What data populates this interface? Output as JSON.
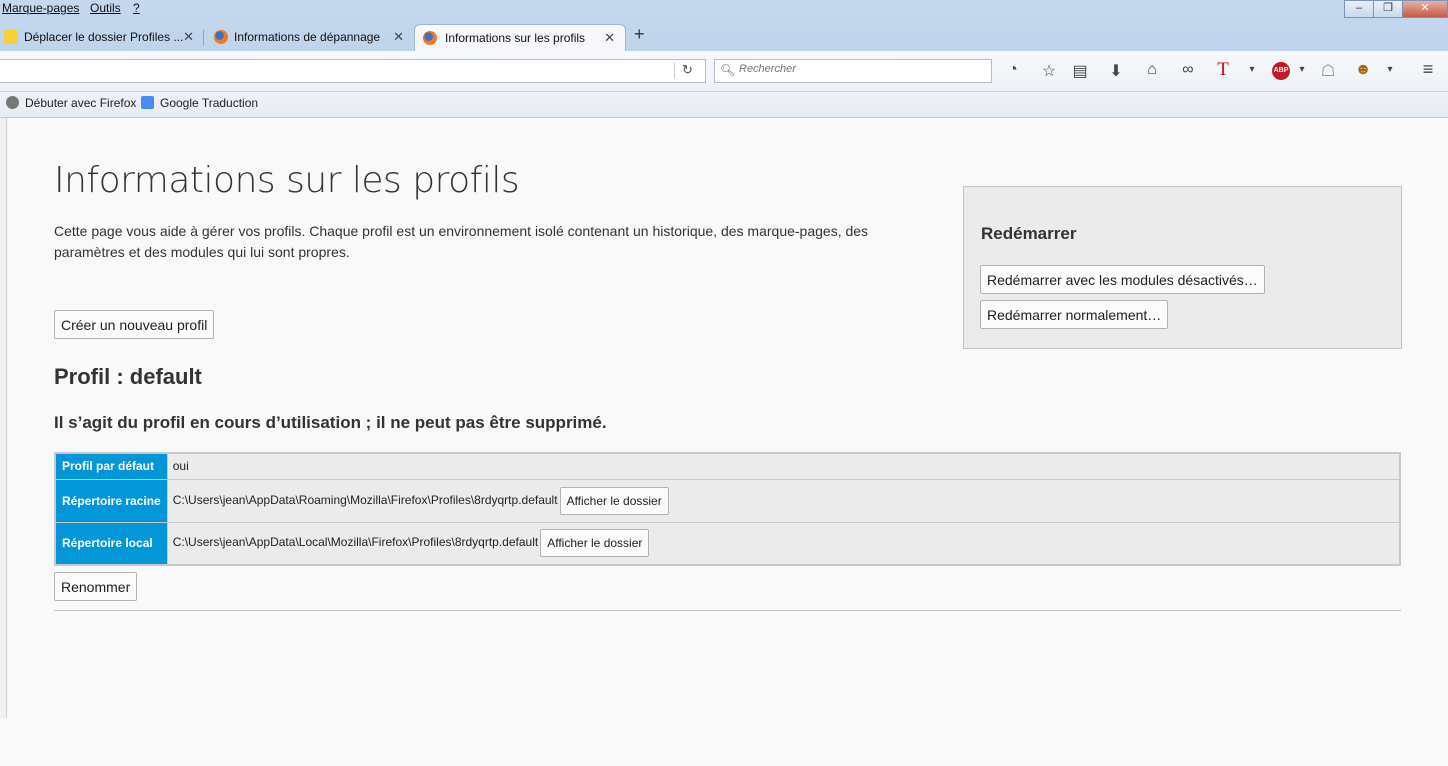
{
  "menubar": {
    "items": [
      "Marque-pages",
      "Outils",
      "?"
    ]
  },
  "tabs": [
    {
      "label": "Déplacer le dossier Profiles ...",
      "active": false
    },
    {
      "label": "Informations de dépannage",
      "active": false
    },
    {
      "label": "Informations sur les profils",
      "active": true
    }
  ],
  "navbar": {
    "url": "",
    "search_placeholder": "Rechercher"
  },
  "bookmarks": [
    "Débuter avec Firefox",
    "Google Traduction"
  ],
  "page": {
    "title": "Informations sur les profils",
    "intro": "Cette page vous aide à gérer vos profils. Chaque profil est un environnement isolé contenant un historique, des marque-pages, des paramètres et des modules qui lui sont propres.",
    "create_profile_button": "Créer un nouveau profil",
    "restart": {
      "heading": "Redémarrer",
      "restart_safe_button": "Redémarrer avec les modules désactivés…",
      "restart_normal_button": "Redémarrer normalement…"
    },
    "profile_heading": "Profil : default",
    "profile_note": "Il s’agit du profil en cours d’utilisation ; il ne peut pas être supprimé.",
    "table": {
      "rows": [
        {
          "label": "Profil par défaut",
          "value": "oui",
          "button": ""
        },
        {
          "label": "Répertoire racine",
          "value": "C:\\Users\\jean\\AppData\\Roaming\\Mozilla\\Firefox\\Profiles\\8rdyqrtp.default",
          "button": "Afficher le dossier"
        },
        {
          "label": "Répertoire local",
          "value": "C:\\Users\\jean\\AppData\\Local\\Mozilla\\Firefox\\Profiles\\8rdyqrtp.default",
          "button": "Afficher le dossier"
        }
      ]
    },
    "rename_button": "Renommer"
  },
  "colors": {
    "header_cell": "#0396d9",
    "chrome": "#c5d8ee"
  },
  "icons": {
    "toolbar": [
      "history-icon",
      "star-icon",
      "reading-list-icon",
      "download-icon",
      "home-icon",
      "mask-icon",
      "text-t-icon",
      "adblock-icon",
      "ghostery-icon",
      "greasemonkey-icon",
      "menu-icon"
    ]
  }
}
